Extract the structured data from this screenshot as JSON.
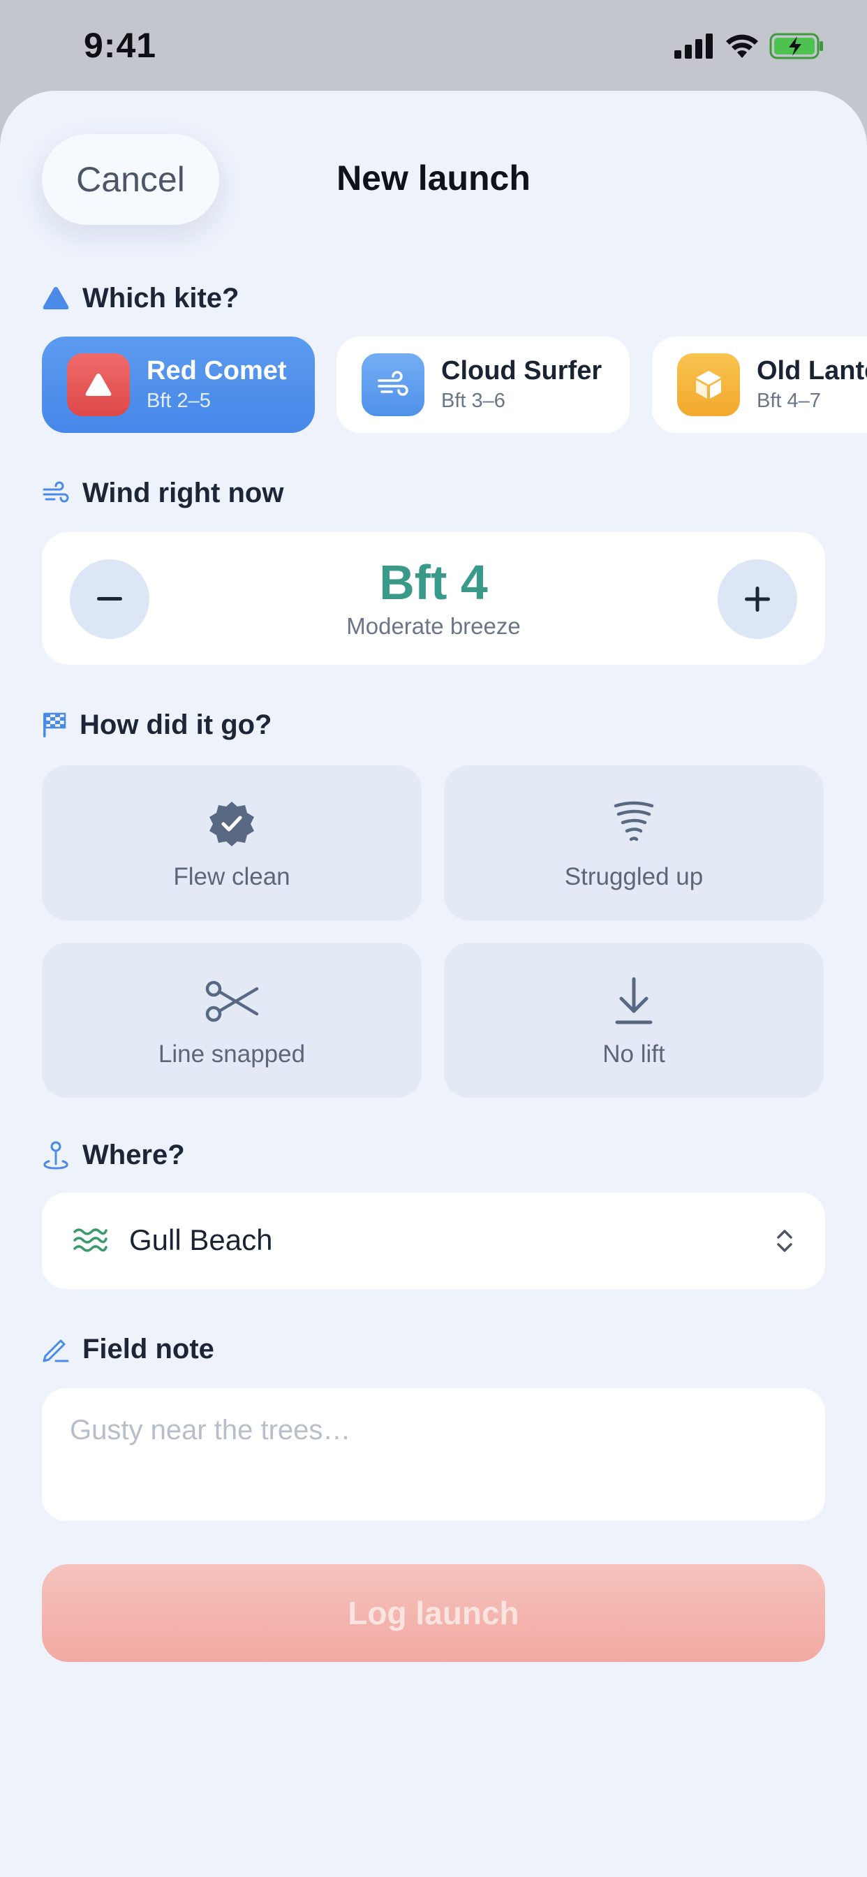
{
  "status_bar": {
    "time": "9:41",
    "icons": [
      "cellular-signal-icon",
      "wifi-icon",
      "battery-charging-icon"
    ]
  },
  "header": {
    "cancel_label": "Cancel",
    "title": "New launch"
  },
  "kite_section": {
    "label": "Which kite?",
    "icon": "triangle-icon",
    "kites": [
      {
        "name": "Red Comet",
        "range": "Bft 2–5",
        "icon": "triangle-icon",
        "color": "#e85a5a",
        "selected": true
      },
      {
        "name": "Cloud Surfer",
        "range": "Bft 3–6",
        "icon": "wind-icon",
        "color": "#5c9eef",
        "selected": false
      },
      {
        "name": "Old Lantern",
        "range": "Bft 4–7",
        "icon": "cube-icon",
        "color": "#f5b43d",
        "selected": false
      }
    ]
  },
  "wind_section": {
    "label": "Wind right now",
    "icon": "wind-icon",
    "value": "Bft 4",
    "description": "Moderate breeze",
    "decrement_icon": "minus-icon",
    "increment_icon": "plus-icon"
  },
  "outcome_section": {
    "label": "How did it go?",
    "icon": "checkered-flag-icon",
    "options": [
      {
        "label": "Flew clean",
        "icon": "verified-badge-icon"
      },
      {
        "label": "Struggled up",
        "icon": "tornado-icon"
      },
      {
        "label": "Line snapped",
        "icon": "scissors-icon"
      },
      {
        "label": "No lift",
        "icon": "arrow-down-icon"
      }
    ]
  },
  "where_section": {
    "label": "Where?",
    "icon": "map-pin-icon",
    "value": "Gull Beach",
    "value_icon": "water-waves-icon",
    "chevron_icon": "chevron-up-down-icon"
  },
  "note_section": {
    "label": "Field note",
    "icon": "pencil-icon",
    "placeholder": "Gusty near the trees…",
    "value": ""
  },
  "submit": {
    "label": "Log launch"
  },
  "colors": {
    "accent_blue": "#4a8ae8",
    "wind_value": "#3a9a8a",
    "submit_disabled": "#f3b4ad",
    "sheet_background": "#edf2fb"
  }
}
